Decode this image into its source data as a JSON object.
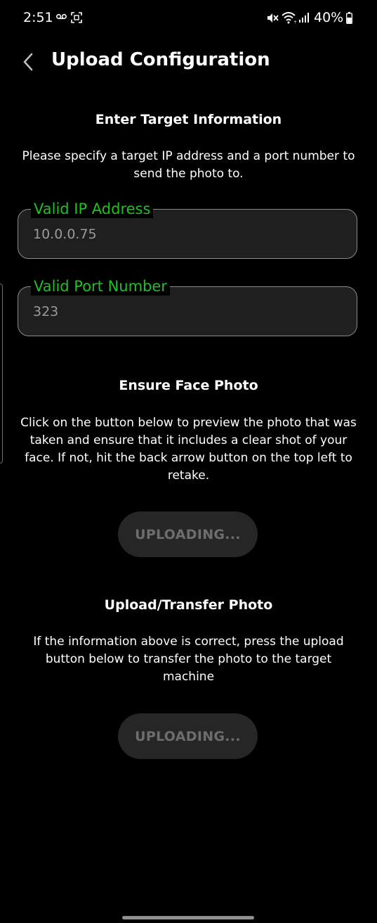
{
  "status_bar": {
    "time": "2:51",
    "battery_percent": "40%",
    "icons": [
      "voicemail-icon",
      "screenshot-icon",
      "mute-icon",
      "wifi-icon",
      "signal-icon",
      "battery-icon"
    ]
  },
  "app_bar": {
    "title": "Upload Configuration",
    "back_icon": "chevron-left-icon"
  },
  "target_section": {
    "heading": "Enter Target Information",
    "description": "Please specify a target IP address and a port number to send the photo to."
  },
  "ip_field": {
    "label": "Valid IP Address",
    "value": "10.0.0.75"
  },
  "port_field": {
    "label": "Valid Port Number",
    "value": "323"
  },
  "face_section": {
    "heading": "Ensure Face Photo",
    "description": "Click on the button below to preview the photo that was taken and ensure that it includes a clear shot of your face. If not, hit the back arrow button on the top left to retake.",
    "button_label": "UPLOADING..."
  },
  "upload_section": {
    "heading": "Upload/Transfer Photo",
    "description": "If the information above is correct, press the upload button below to transfer the photo to the target machine",
    "button_label": "UPLOADING..."
  },
  "colors": {
    "background": "#000000",
    "field_label": "#1ec21e",
    "field_background": "#1f1f1f",
    "button_background": "#262626",
    "button_text": "#6d6d6d"
  }
}
